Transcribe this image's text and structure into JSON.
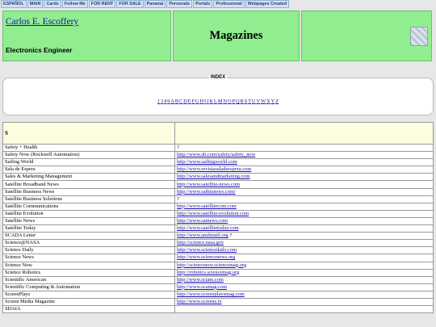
{
  "nav": [
    "ESPAÑOL",
    "MAIN",
    "Cards",
    "Follow Me",
    "FOR RENT",
    "FOR SALE",
    "Panamá",
    "Personals",
    "Portals",
    "Professional",
    "Webpages Created"
  ],
  "header": {
    "author": "Carlos E. Escoffery",
    "profession": "Electronics Engineer",
    "title": "Magazines",
    "thumb_icon": "photo-thumbnail-icon"
  },
  "index": {
    "label": "INDEX",
    "letters": [
      "1",
      "3",
      "4",
      "9",
      "A",
      "B",
      "C",
      "D",
      "E",
      "F",
      "G",
      "H",
      "I",
      "J",
      "K",
      "L",
      "M",
      "N",
      "O",
      "P",
      "Q",
      "R",
      "S",
      "T",
      "U",
      "V",
      "W",
      "X",
      "Y",
      "Z"
    ]
  },
  "section": "S",
  "rows": [
    {
      "name": "Safety + Health",
      "link": "",
      "note": "?"
    },
    {
      "name": "Safety Now (Rockwell Automation)",
      "link": "http://www.ab.com/safety/safety_now",
      "note": ""
    },
    {
      "name": "Sailing World",
      "link": "http://www.sailingworld.com",
      "note": ""
    },
    {
      "name": "Sala de Espera",
      "link": "http://www.revistasaladeespera.com",
      "note": ""
    },
    {
      "name": "Sales & Marketing Management",
      "link": "http://www.salesandmarketing.com",
      "note": ""
    },
    {
      "name": "Satellite Broadband News",
      "link": "http://www.satellite-news.com",
      "note": ""
    },
    {
      "name": "Satellite Business News",
      "link": "http://www.satbiznews.com/",
      "note": ""
    },
    {
      "name": "Satellite Business Solutions",
      "link": "",
      "note": "?"
    },
    {
      "name": "Satellite Communications",
      "link": "http://www.satellitecom.com",
      "note": ""
    },
    {
      "name": "Satellite Evolution",
      "link": "http://www.satellite-evolution.com",
      "note": ""
    },
    {
      "name": "Satellite News",
      "link": "http://www.satnews.com",
      "note": ""
    },
    {
      "name": "Satellite Today",
      "link": "http://www.satellitetoday.com",
      "note": ""
    },
    {
      "name": "SCADA Letter",
      "link": "http://www.amfmutil.org",
      "note": " ?"
    },
    {
      "name": "Science@NASA",
      "link": "http://science.nasa.gov",
      "note": ""
    },
    {
      "name": "Science Daily",
      "link": "http://www.sciencedaily.com",
      "note": ""
    },
    {
      "name": "Science News",
      "link": "http://www.sciencenews.org",
      "note": ""
    },
    {
      "name": "Science Now",
      "link": "http://sciencenow.sciencemag.org",
      "note": ""
    },
    {
      "name": "Science Robotics",
      "link": "http://robotics.sciencemag.org",
      "note": ""
    },
    {
      "name": "Scientific American",
      "link": "http://www.sciam.com",
      "note": ""
    },
    {
      "name": "Scientific Computing & Automation",
      "link": "http://www.scamag.com",
      "note": ""
    },
    {
      "name": "ScreenPlays",
      "link": "http://www.screenplaysmag.com",
      "note": ""
    },
    {
      "name": "Screen Media Magazine",
      "link": "http://www.screens.tv",
      "note": ""
    },
    {
      "name": "SDAIA",
      "link": "",
      "note": ""
    }
  ]
}
